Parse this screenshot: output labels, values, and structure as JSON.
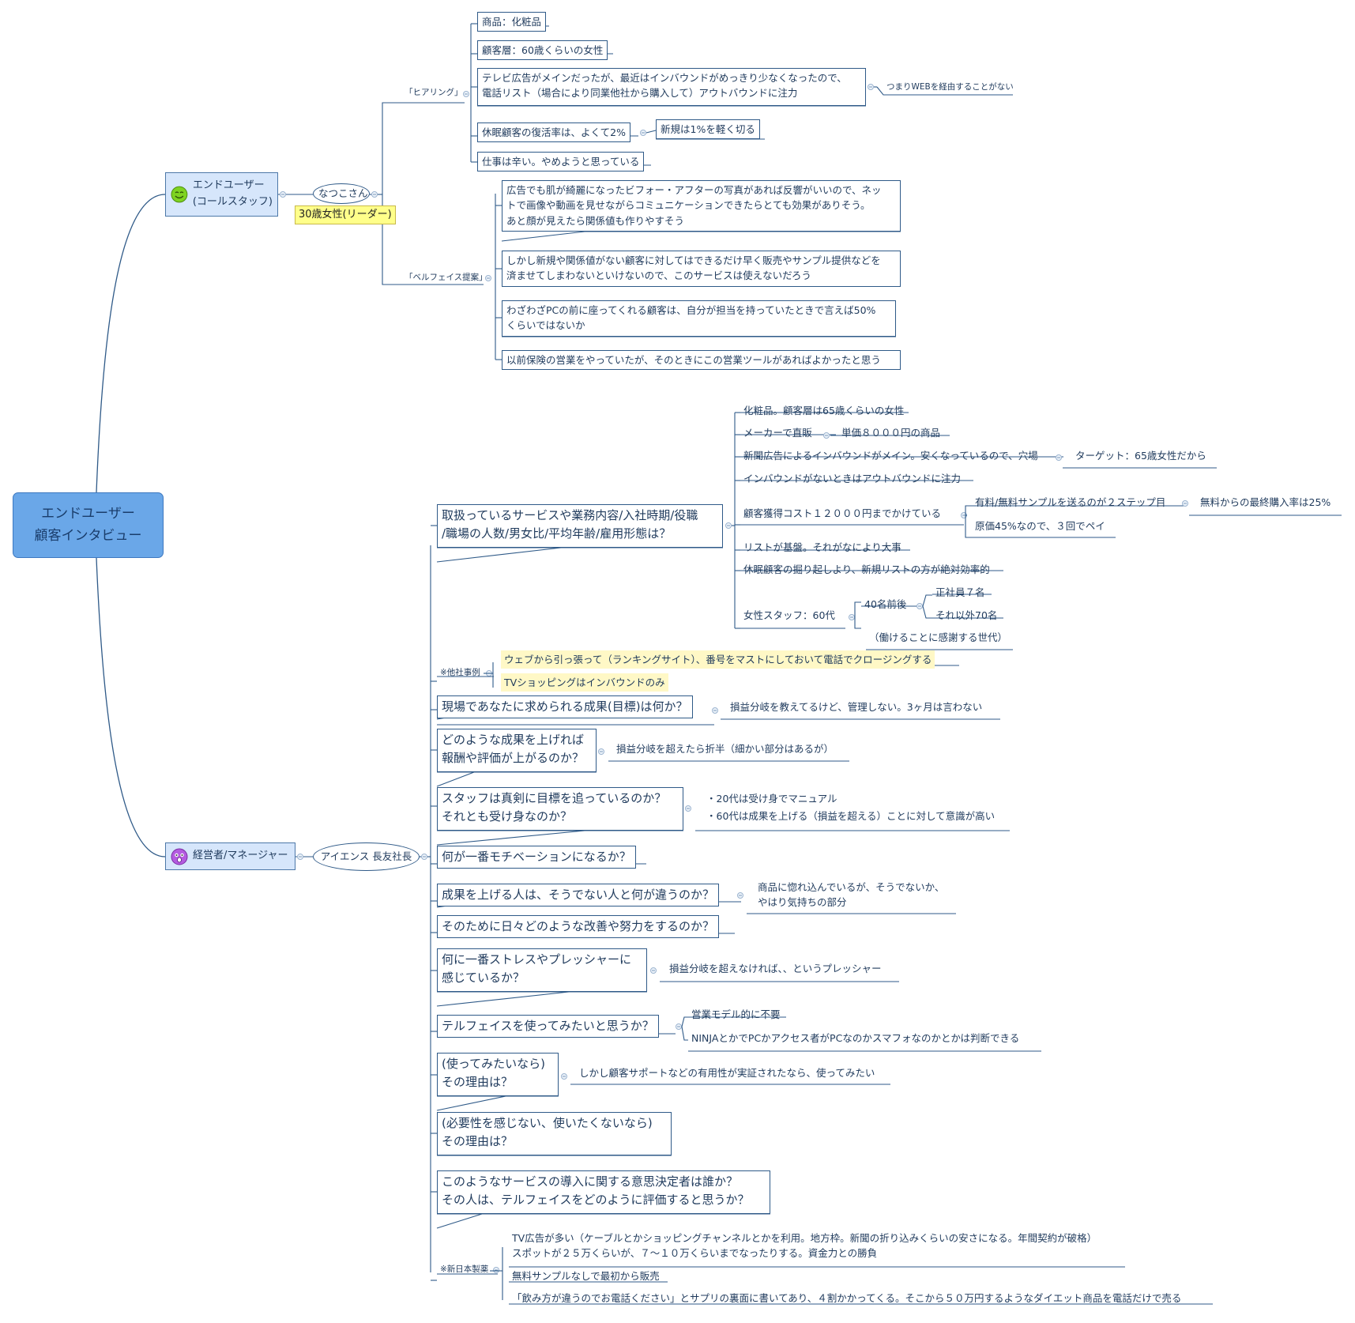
{
  "root": {
    "line1": "エンドユーザー",
    "line2": "顧客インタビュー"
  },
  "personas": {
    "enduser": {
      "line1": "エンドユーザー",
      "line2": "(コールスタッフ)",
      "icon": "smile-face-icon",
      "icon_color": "#7ed321"
    },
    "manager": {
      "label": "経営者/マネージャー",
      "icon": "surprised-face-icon",
      "icon_color": "#b45be0"
    }
  },
  "enduser_branch": {
    "person": "なつこさん",
    "person_tag": "30歳女性(リーダー)",
    "hearing": {
      "label": "「ヒアリング」",
      "items": [
        "商品：化粧品",
        "顧客層：60歳くらいの女性",
        [
          "テレビ広告がメインだったが、最近はインバウンドがめっきり少なくなったので、",
          "電話リスト（場合により同業他社から購入して）アウトバウンドに注力"
        ],
        "休眠顧客の復活率は、よくて2%",
        "仕事は辛い。やめようと思っている"
      ],
      "note_web": "つまりWEBを経由することがない",
      "note_new": "新規は1%を軽く切る"
    },
    "bellface": {
      "label": "「ベルフェイス提案」",
      "items": [
        [
          "広告でも肌が綺麗になったビフォー・アフターの写真があれば反響がいいので、ネッ",
          "トで画像や動画を見せながらコミュニケーションできたらとても効果がありそう。",
          "あと顔が見えたら関係値も作りやすそう"
        ],
        [
          "しかし新規や関係値がない顧客に対してはできるだけ早く販売やサンプル提供などを",
          "済ませてしまわないといけないので、このサービスは使えないだろう"
        ],
        [
          "わざわざPCの前に座ってくれる顧客は、自分が担当を持っていたときで言えば50%",
          "くらいではないか"
        ],
        "以前保険の営業をやっていたが、そのときにこの営業ツールがあればよかったと思う"
      ]
    }
  },
  "manager_branch": {
    "person": "アイエンス 長友社長",
    "q1": {
      "label": [
        "取扱っているサービスや業務内容/入社時期/役職",
        "/職場の人数/男女比/平均年齢/雇用形態は？"
      ],
      "answers": {
        "a1": "化粧品。顧客層は65歳くらいの女性",
        "a2": "メーカーで直販",
        "a2b": "単価８０００円の商品",
        "a3": "新聞広告によるインバウンドがメイン。安くなっているので、穴場",
        "a3b": "ターゲット：65歳女性だから",
        "a4": "インバウンドがないときはアウトバウンドに注力",
        "a5": "顧客獲得コスト１２０００円までかけている",
        "a5b": "有料/無料サンプルを送るのが２ステップ目",
        "a5c": "無料からの最終購入率は25%",
        "a5d": "原価45%なので、３回でペイ",
        "a6": "リストが基盤。それがなにより大事",
        "a7": "休眠顧客の掘り起しより、新規リストの方が絶対効率的",
        "a8": "女性スタッフ：60代",
        "a8b": "40名前後",
        "a8c": "正社員７名",
        "a8d": "それ以外70名",
        "a8e": "（働けることに感謝する世代）"
      }
    },
    "other": {
      "label": "※他社事例",
      "items": [
        "ウェブから引っ張って（ランキングサイト）、番号をマストにしておいて電話でクロージングする",
        "TVショッピングはインバウンドのみ"
      ]
    },
    "q2": {
      "label": "現場であなたに求められる成果(目標)は何か？",
      "answer": "損益分岐を教えてるけど、管理しない。3ヶ月は言わない"
    },
    "q3": {
      "label": [
        "どのような成果を上げれば",
        "報酬や評価が上がるのか？"
      ],
      "answer": "損益分岐を超えたら折半（細かい部分はあるが）"
    },
    "q4": {
      "label": [
        "スタッフは真剣に目標を追っているのか？",
        "それとも受け身なのか？"
      ],
      "answer": [
        "・20代は受け身でマニュアル",
        "・60代は成果を上げる（損益を超える）ことに対して意識が高い"
      ]
    },
    "q5": {
      "label": "何が一番モチベーションになるか？"
    },
    "q6": {
      "label": "成果を上げる人は、そうでない人と何が違うのか？",
      "answer": [
        "商品に惚れ込んでいるが、そうでないか、",
        "やはり気持ちの部分"
      ]
    },
    "q7": {
      "label": "そのために日々どのような改善や努力をするのか？"
    },
    "q8": {
      "label": [
        "何に一番ストレスやプレッシャーに",
        "感じているか？"
      ],
      "answer": "損益分岐を超えなければ、、というプレッシャー"
    },
    "q9": {
      "label": "テルフェイスを使ってみたいと思うか？",
      "answers": [
        "営業モデル的に不要",
        "NINJAとかでPCかアクセス者がPCなのかスマフォなのかとかは判断できる"
      ]
    },
    "q10": {
      "label": [
        "(使ってみたいなら)",
        "その理由は？"
      ],
      "answer": "しかし顧客サポートなどの有用性が実証されたなら、使ってみたい"
    },
    "q11": {
      "label": [
        "(必要性を感じない、使いたくないなら)",
        "その理由は？"
      ]
    },
    "q12": {
      "label": [
        "このようなサービスの導入に関する意思決定者は誰か？",
        "その人は、テルフェイスをどのように評価すると思うか？"
      ]
    },
    "nihon": {
      "label": "※新日本製薬",
      "items": [
        [
          "TV広告が多い（ケーブルとかショッピングチャンネルとかを利用。地方枠。新聞の折り込みくらいの安さになる。年間契約が破格）",
          "スポットが２５万くらいが、７〜１０万くらいまでなったりする。資金力との勝負"
        ],
        "無料サンプルなしで最初から販売",
        "「飲み方が違うのでお電話ください」とサプリの裏面に書いてあり、４割かかってくる。そこから５０万円するようなダイエット商品を電話だけで売る"
      ]
    }
  }
}
